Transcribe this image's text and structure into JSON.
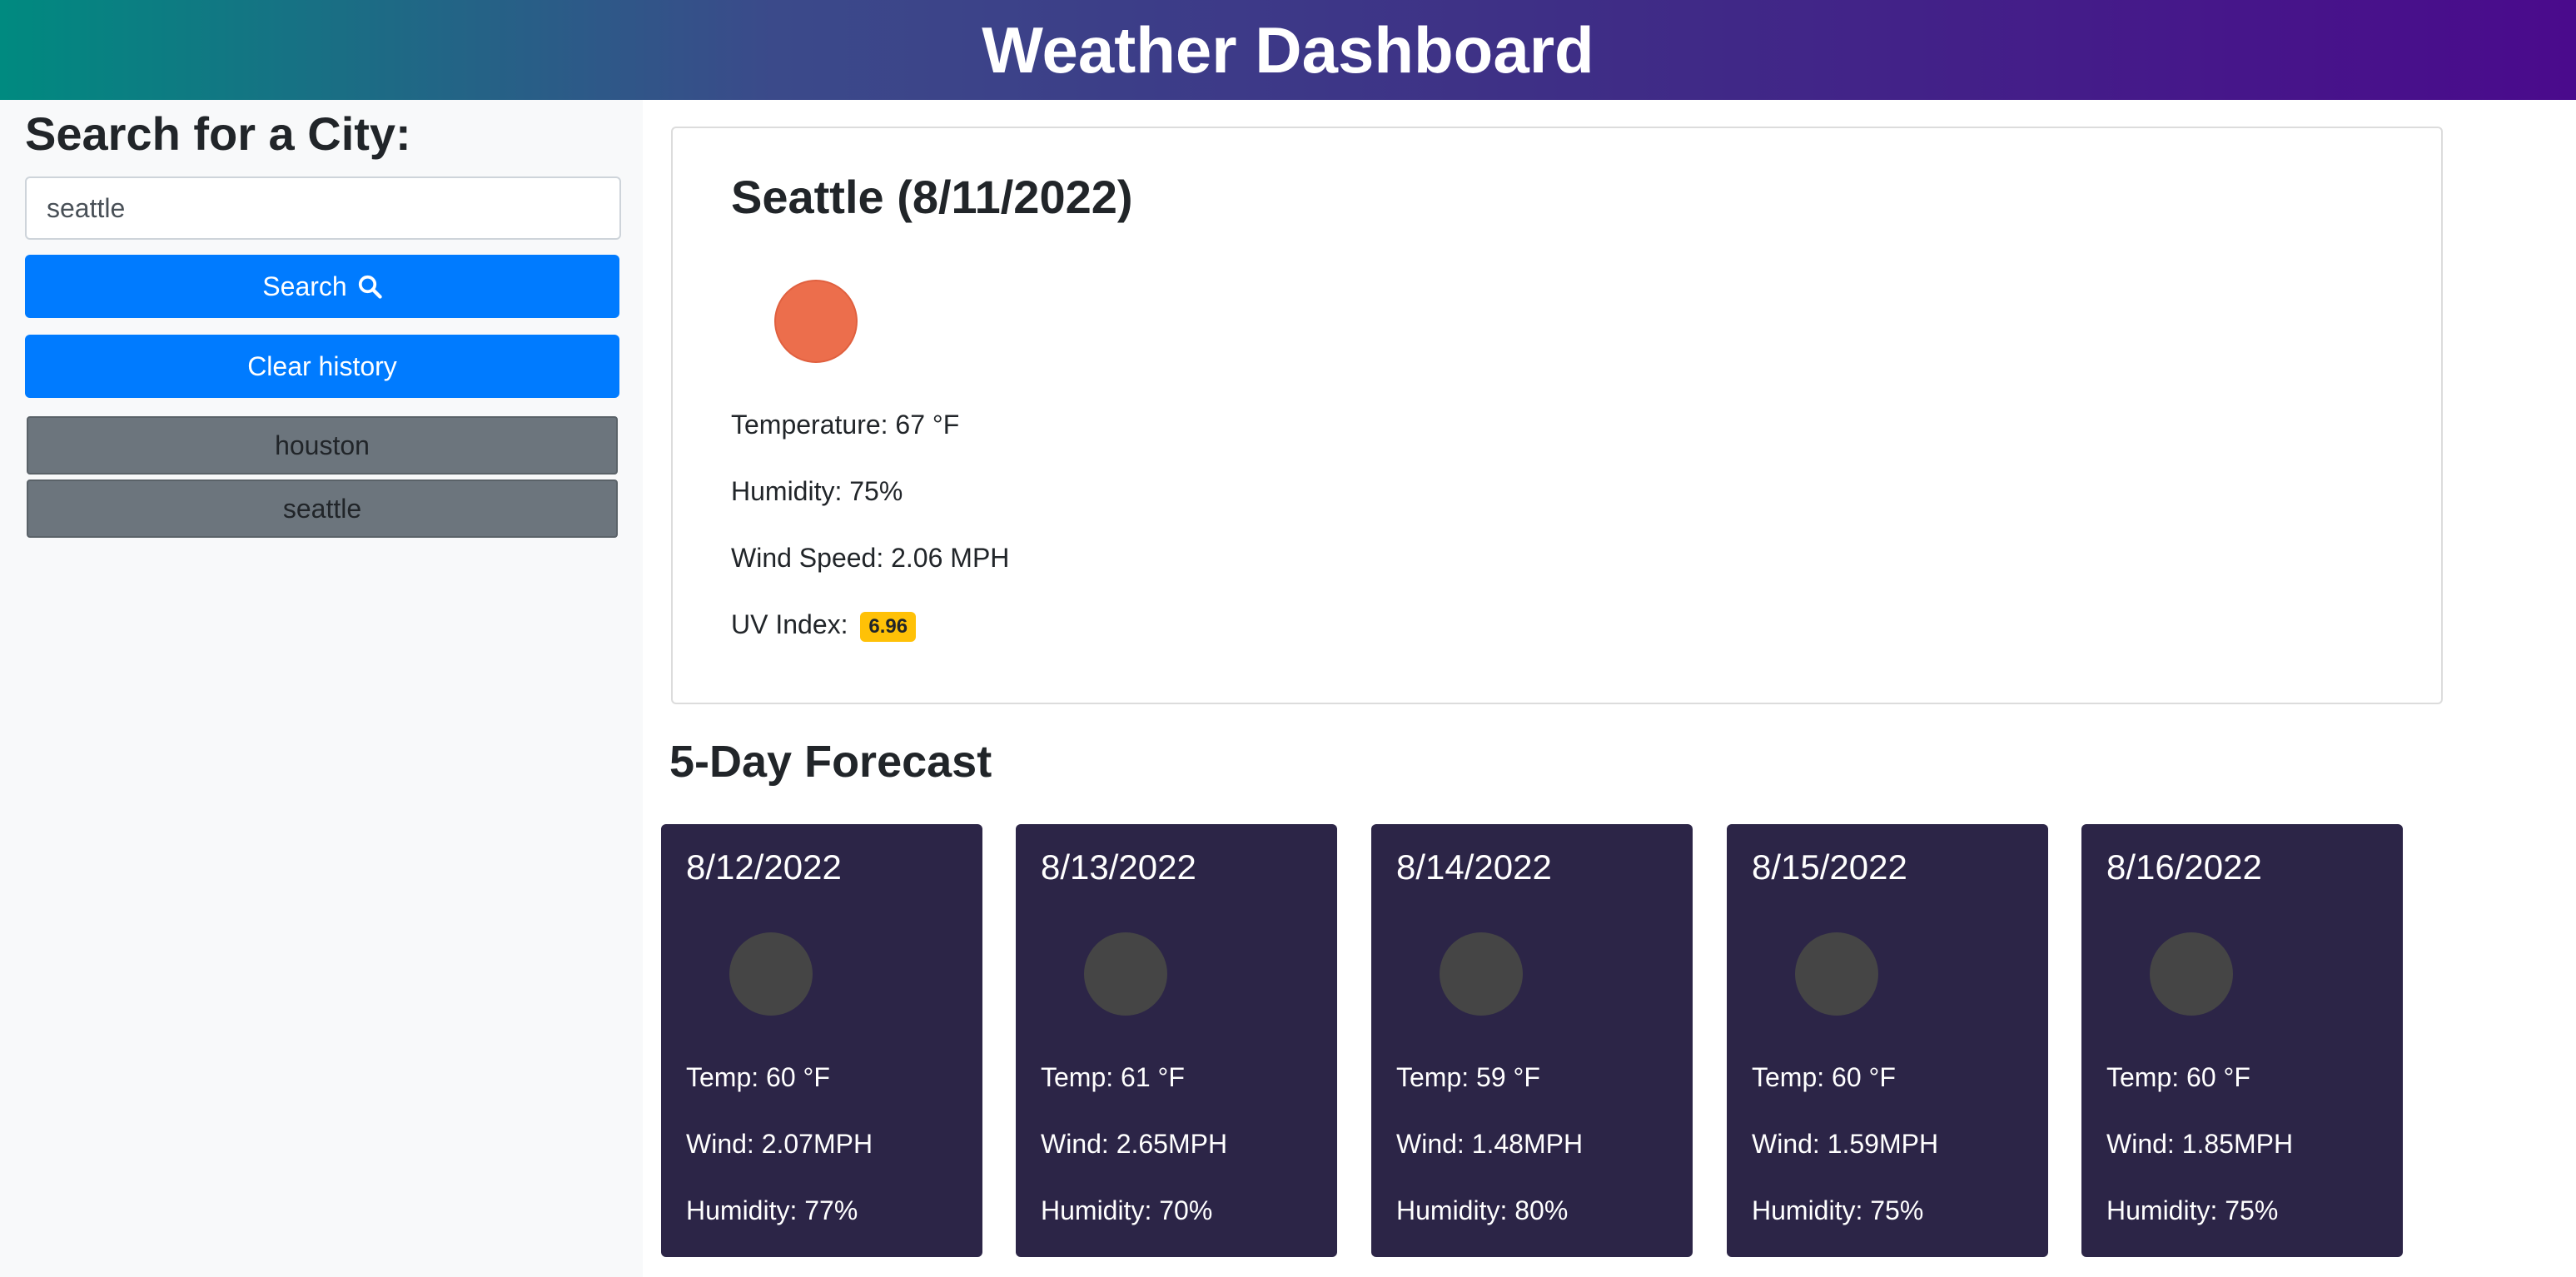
{
  "header": {
    "title": "Weather Dashboard"
  },
  "sidebar": {
    "heading": "Search for a City:",
    "search_value": "seattle",
    "search_button": "Search",
    "clear_button": "Clear history",
    "history": [
      "houston",
      "seattle"
    ]
  },
  "current": {
    "city_date": "Seattle (8/11/2022)",
    "icon": "sun-icon",
    "temperature": "Temperature: 67 °F",
    "humidity": "Humidity: 75%",
    "wind": "Wind Speed: 2.06 MPH",
    "uv_label": "UV Index:",
    "uv_value": "6.96"
  },
  "forecast": {
    "title": "5-Day Forecast",
    "days": [
      {
        "date": "8/12/2022",
        "temp": "Temp: 60 °F",
        "wind": "Wind: 2.07MPH",
        "humidity": "Humidity: 77%"
      },
      {
        "date": "8/13/2022",
        "temp": "Temp: 61 °F",
        "wind": "Wind: 2.65MPH",
        "humidity": "Humidity: 70%"
      },
      {
        "date": "8/14/2022",
        "temp": "Temp: 59 °F",
        "wind": "Wind: 1.48MPH",
        "humidity": "Humidity: 80%"
      },
      {
        "date": "8/15/2022",
        "temp": "Temp: 60 °F",
        "wind": "Wind: 1.59MPH",
        "humidity": "Humidity: 75%"
      },
      {
        "date": "8/16/2022",
        "temp": "Temp: 60 °F",
        "wind": "Wind: 1.85MPH",
        "humidity": "Humidity: 75%"
      }
    ]
  },
  "colors": {
    "primary_button": "#007bff",
    "history_button": "#6c757d",
    "forecast_card": "#2c2547",
    "uv_badge": "#ffc107",
    "sun": "#ec6e4c"
  }
}
